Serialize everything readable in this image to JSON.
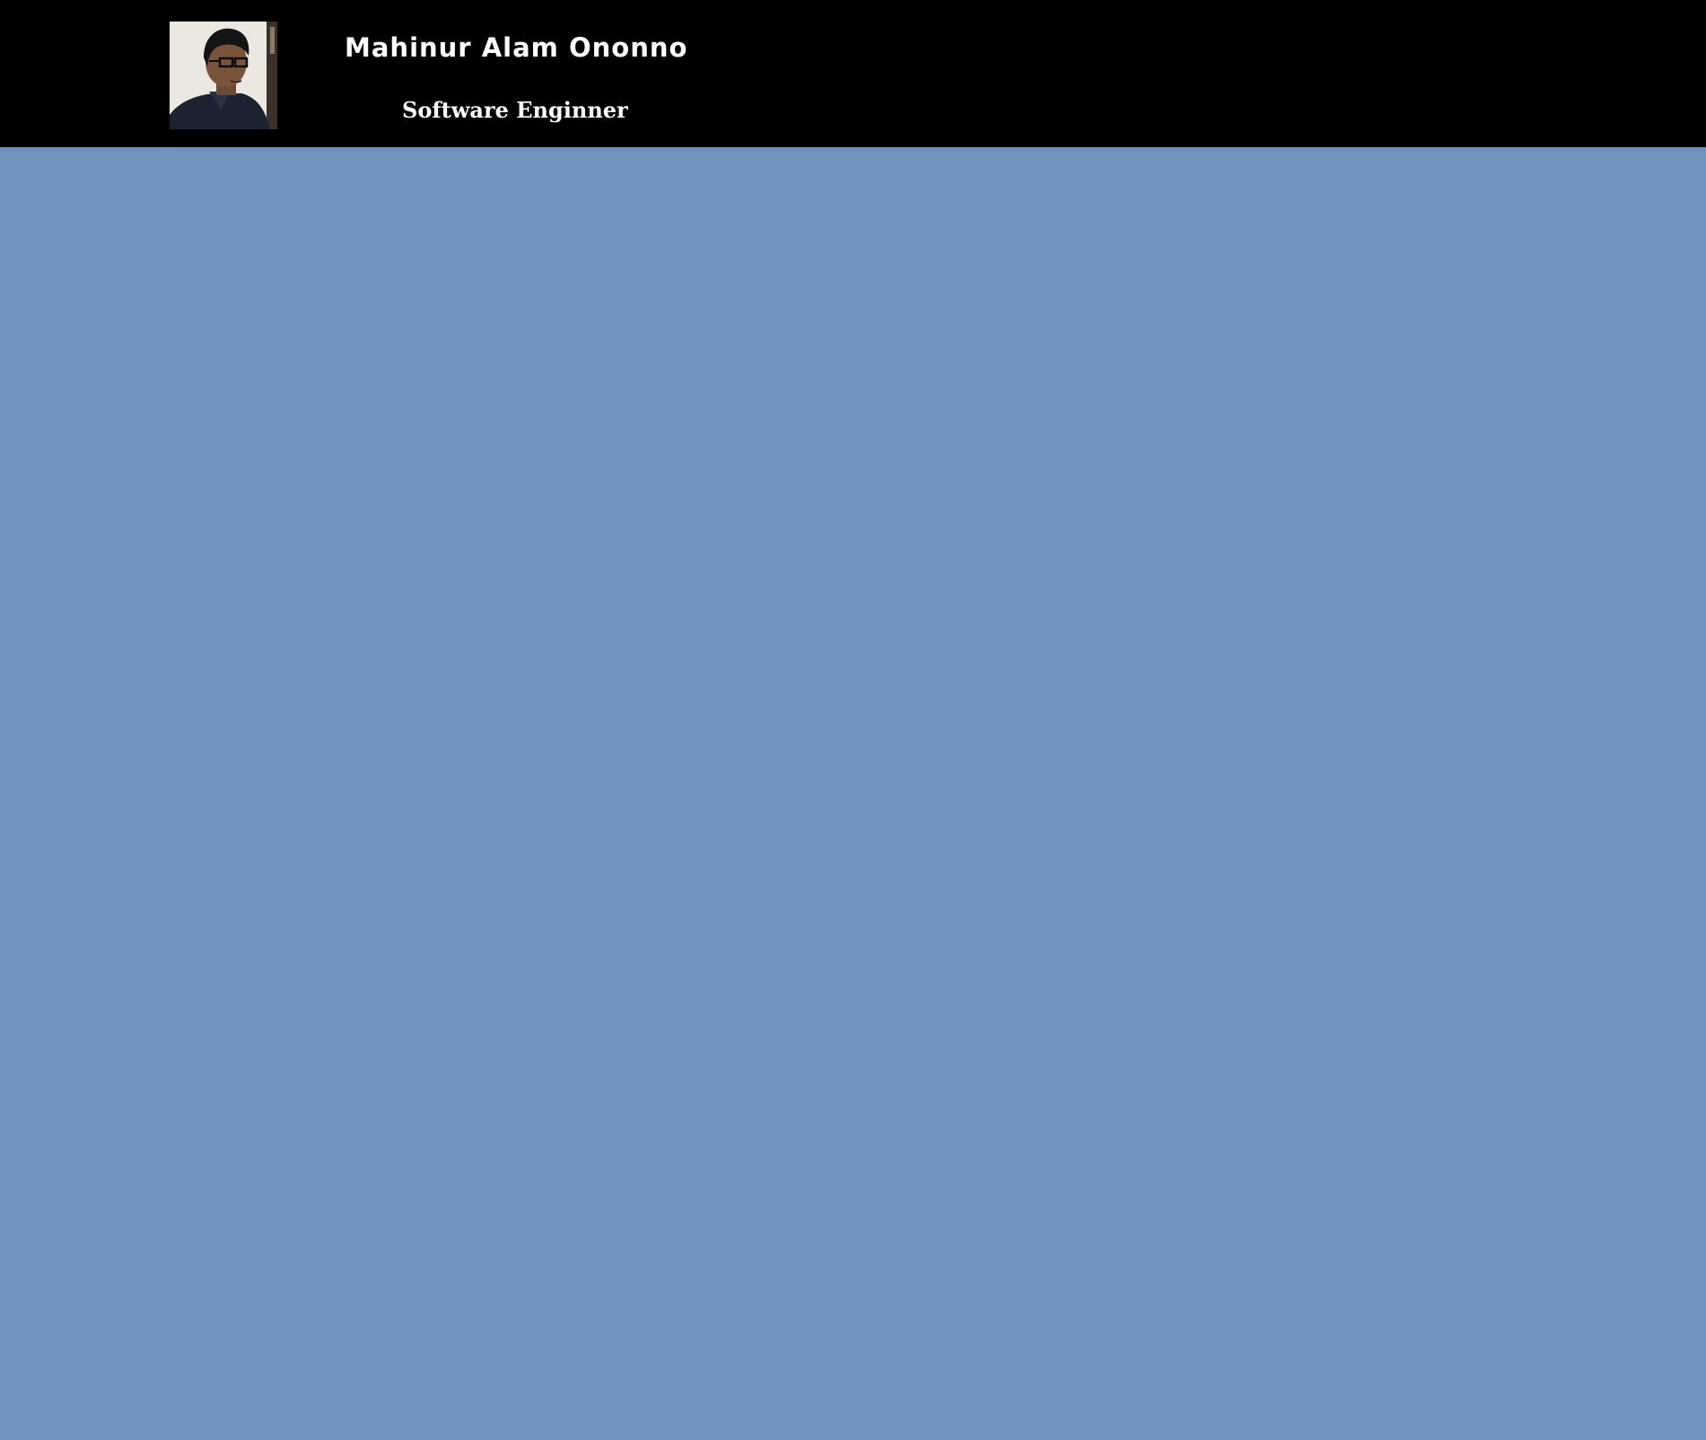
{
  "header": {
    "name": "Mahinur Alam Ononno",
    "role": "Software Enginner"
  },
  "colors": {
    "header_background": "#000000",
    "page_background": "#7092bf",
    "header_text": "#ffffff"
  }
}
